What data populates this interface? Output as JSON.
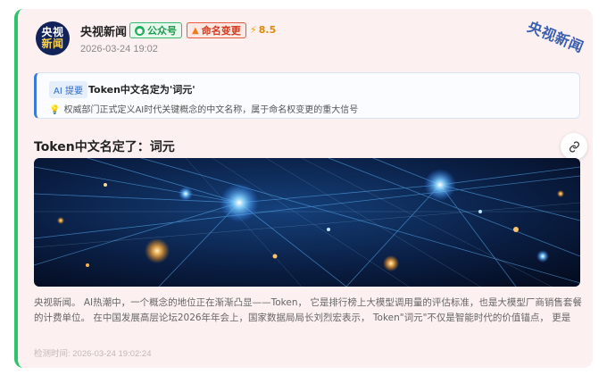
{
  "account": {
    "avatar_line1": "央视",
    "avatar_line2": "新闻",
    "name": "央视新闻",
    "type_badge": "公众号",
    "tag_badge": "命名变更",
    "score": "8.5",
    "date": "2026-03-24 19:02"
  },
  "watermark": "央视新闻",
  "summary": {
    "ai_label": "AI 提要",
    "title": "Token中文名定为'词元'",
    "text": "权威部门正式定义AI时代关键概念的中文名称，属于命名权变更的重大信号"
  },
  "article": {
    "title": "Token中文名定了：词元",
    "body": "央视新闻。 AI热潮中，一个概念的地位正在渐渐凸显——Token， 它是排行榜上大模型调用量的评估标准，也是大模型厂商销售套餐的计费单位。 在中国发展高层论坛2026年年会上，国家数据局局长刘烈宏表示， Token\"词元\"不仅是智能时代的价值锚点， 更是连..."
  },
  "detected_at": "检测时间: 2026-03-24 19:02:24",
  "icons": [
    "wechat-icon",
    "fire-icon",
    "bolt-icon",
    "lightbulb-icon",
    "link-icon"
  ],
  "colors": {
    "accent_green": "#2ec26a",
    "card_bg": "#fdf0f0",
    "summary_border": "#3a7bd5",
    "tag_red": "#d23a1f",
    "score_orange": "#e08a00"
  }
}
